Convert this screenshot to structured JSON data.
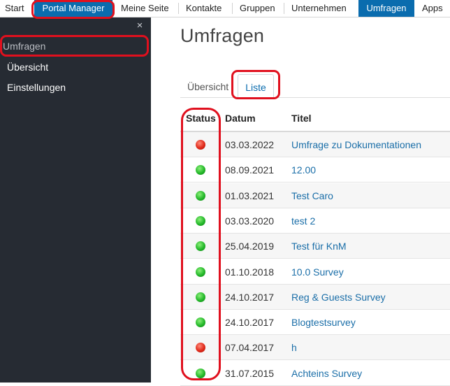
{
  "topnav": {
    "items": [
      "Start",
      "Portal Manager",
      "Meine Seite",
      "Kontakte",
      "Gruppen",
      "Unternehmen",
      "Umfragen",
      "Apps"
    ]
  },
  "sidebar": {
    "close_icon": "×",
    "items": [
      "Umfragen",
      "Übersicht",
      "Einstellungen"
    ]
  },
  "main": {
    "title": "Umfragen",
    "tabs": [
      "Übersicht",
      "Liste"
    ],
    "table": {
      "headers": [
        "Status",
        "Datum",
        "Titel"
      ],
      "rows": [
        {
          "status": "red",
          "date": "03.03.2022",
          "title": "Umfrage zu Dokumentationen"
        },
        {
          "status": "green",
          "date": "08.09.2021",
          "title": "12.00"
        },
        {
          "status": "green",
          "date": "01.03.2021",
          "title": "Test Caro"
        },
        {
          "status": "green",
          "date": "03.03.2020",
          "title": "test 2"
        },
        {
          "status": "green",
          "date": "25.04.2019",
          "title": "Test für KnM"
        },
        {
          "status": "green",
          "date": "01.10.2018",
          "title": "10.0 Survey"
        },
        {
          "status": "green",
          "date": "24.10.2017",
          "title": "Reg & Guests Survey"
        },
        {
          "status": "green",
          "date": "24.10.2017",
          "title": "Blogtestsurvey"
        },
        {
          "status": "red",
          "date": "07.04.2017",
          "title": "h"
        },
        {
          "status": "green",
          "date": "31.07.2015",
          "title": "Achteins Survey"
        }
      ]
    }
  },
  "colors": {
    "brand_blue": "#0a6cae",
    "sidebar_bg": "#262b33",
    "highlight_red": "#e0101e",
    "status_active": "#24b82a",
    "status_inactive": "#e02a1a"
  }
}
